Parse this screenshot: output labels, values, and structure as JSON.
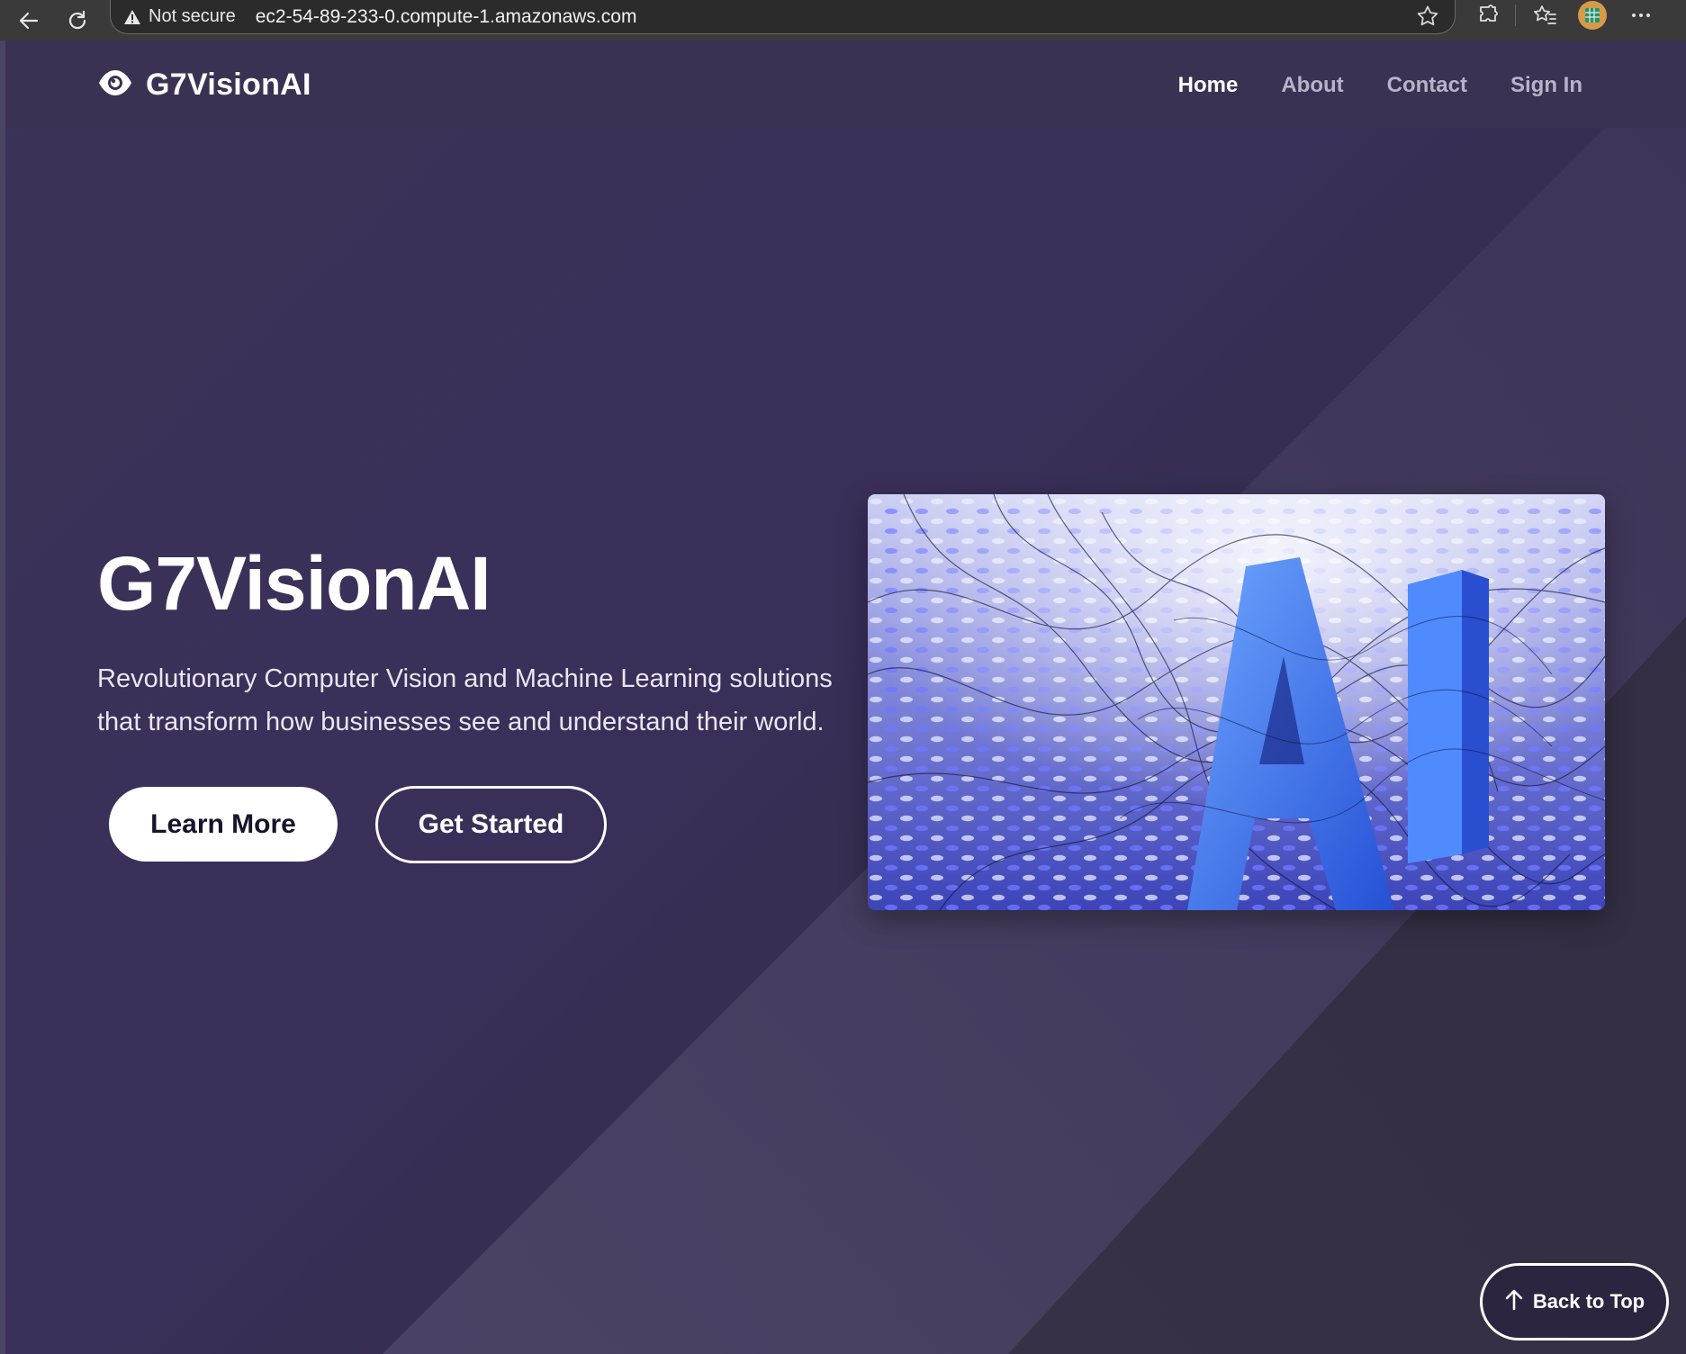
{
  "browser": {
    "security_label": "Not secure",
    "url": "ec2-54-89-233-0.compute-1.amazonaws.com",
    "icons": [
      "back-arrow-icon",
      "reload-icon",
      "warning-icon",
      "favorite-star-icon",
      "extensions-icon",
      "favorites-icon",
      "extension-badge-icon",
      "more-icon"
    ]
  },
  "site": {
    "logo_text": "G7VisionAI",
    "logo_icon": "eye-icon",
    "nav": [
      {
        "label": "Home",
        "active": true
      },
      {
        "label": "About",
        "active": false
      },
      {
        "label": "Contact",
        "active": false
      },
      {
        "label": "Sign In",
        "active": false
      }
    ]
  },
  "hero": {
    "title": "G7VisionAI",
    "subtitle_line1": "Revolutionary Computer Vision and Machine Learning solutions",
    "subtitle_line2": "that transform how businesses see and understand their world.",
    "primary_button": "Learn More",
    "secondary_button": "Get Started",
    "image_letters": "AI"
  },
  "footer": {
    "back_to_top": "Back to Top",
    "back_to_top_icon": "arrow-up-icon"
  },
  "colors": {
    "background_top": "#3c3358",
    "background_bottom": "#27242f",
    "header_bg": "#3b3153",
    "nav_active": "#ffffff",
    "nav_inactive": "#b9b3c9",
    "image_blue": "#4f63d8"
  }
}
